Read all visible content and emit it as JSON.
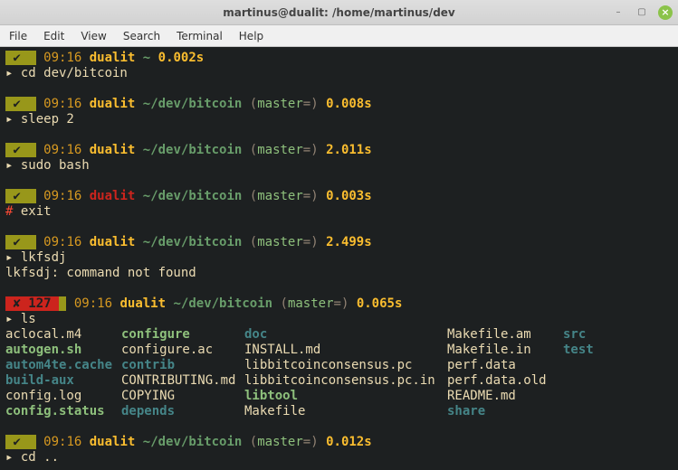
{
  "window": {
    "title": "martinus@dualit: /home/martinus/dev"
  },
  "menu": {
    "file": "File",
    "edit": "Edit",
    "view": "View",
    "search": "Search",
    "terminal": "Terminal",
    "help": "Help"
  },
  "prompts": [
    {
      "status": "ok",
      "time": "09:16",
      "host": "dualit",
      "host_color": "yellow",
      "path": "~",
      "git": "",
      "duration": "0.002s",
      "cmd": "cd dev/bitcoin",
      "cmd_prefix": "▸ "
    },
    {
      "status": "ok",
      "time": "09:16",
      "host": "dualit",
      "host_color": "yellow",
      "path": "~/dev/bitcoin",
      "git": "(master=)",
      "duration": "0.008s",
      "cmd": "sleep 2",
      "cmd_prefix": "▸ "
    },
    {
      "status": "ok",
      "time": "09:16",
      "host": "dualit",
      "host_color": "yellow",
      "path": "~/dev/bitcoin",
      "git": "(master=)",
      "duration": "2.011s",
      "cmd": "sudo bash",
      "cmd_prefix": "▸ "
    },
    {
      "status": "ok",
      "time": "09:16",
      "host": "dualit",
      "host_color": "red",
      "path": "~/dev/bitcoin",
      "git": "(master=)",
      "duration": "0.003s",
      "cmd": "exit",
      "cmd_prefix": "# "
    },
    {
      "status": "ok",
      "time": "09:16",
      "host": "dualit",
      "host_color": "yellow",
      "path": "~/dev/bitcoin",
      "git": "(master=)",
      "duration": "2.499s",
      "cmd": "lkfsdj",
      "cmd_prefix": "▸ ",
      "output": "lkfsdj: command not found"
    },
    {
      "status": "err",
      "code": "127",
      "time": "09:16",
      "host": "dualit",
      "host_color": "yellow",
      "path": "~/dev/bitcoin",
      "git": "(master=)",
      "duration": "0.065s",
      "cmd": "ls",
      "cmd_prefix": "▸ "
    },
    {
      "status": "ok",
      "time": "09:16",
      "host": "dualit",
      "host_color": "yellow",
      "path": "~/dev/bitcoin",
      "git": "(master=)",
      "duration": "0.012s",
      "cmd": "cd ..",
      "cmd_prefix": "▸ "
    }
  ],
  "ls": {
    "rows": [
      {
        "c1": {
          "t": "aclocal.m4",
          "k": "f"
        },
        "c2": {
          "t": "configure",
          "k": "x"
        },
        "c3": {
          "t": "doc",
          "k": "d"
        },
        "c4": {
          "t": "Makefile.am",
          "k": "f"
        },
        "c5": {
          "t": "src",
          "k": "d"
        }
      },
      {
        "c1": {
          "t": "autogen.sh",
          "k": "x"
        },
        "c2": {
          "t": "configure.ac",
          "k": "f"
        },
        "c3": {
          "t": "INSTALL.md",
          "k": "f"
        },
        "c4": {
          "t": "Makefile.in",
          "k": "f"
        },
        "c5": {
          "t": "test",
          "k": "d"
        }
      },
      {
        "c1": {
          "t": "autom4te.cache",
          "k": "d"
        },
        "c2": {
          "t": "contrib",
          "k": "d"
        },
        "c3": {
          "t": "libbitcoinconsensus.pc",
          "k": "f"
        },
        "c4": {
          "t": "perf.data",
          "k": "f"
        },
        "c5": {
          "t": "",
          "k": "f"
        }
      },
      {
        "c1": {
          "t": "build-aux",
          "k": "d"
        },
        "c2": {
          "t": "CONTRIBUTING.md",
          "k": "f"
        },
        "c3": {
          "t": "libbitcoinconsensus.pc.in",
          "k": "f"
        },
        "c4": {
          "t": "perf.data.old",
          "k": "f"
        },
        "c5": {
          "t": "",
          "k": "f"
        }
      },
      {
        "c1": {
          "t": "config.log",
          "k": "f"
        },
        "c2": {
          "t": "COPYING",
          "k": "f"
        },
        "c3": {
          "t": "libtool",
          "k": "x"
        },
        "c4": {
          "t": "README.md",
          "k": "f"
        },
        "c5": {
          "t": "",
          "k": "f"
        }
      },
      {
        "c1": {
          "t": "config.status",
          "k": "x"
        },
        "c2": {
          "t": "depends",
          "k": "d"
        },
        "c3": {
          "t": "Makefile",
          "k": "f"
        },
        "c4": {
          "t": "share",
          "k": "d"
        },
        "c5": {
          "t": "",
          "k": "f"
        }
      }
    ]
  },
  "glyph": {
    "check": "✔",
    "cross": "✘"
  }
}
